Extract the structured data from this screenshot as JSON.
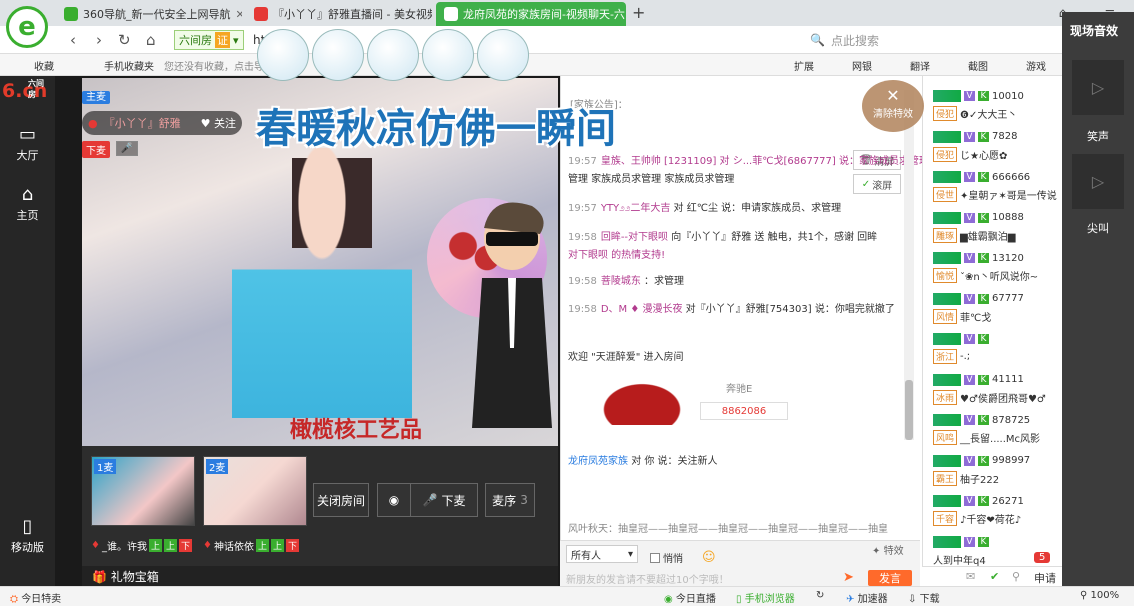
{
  "tabs": [
    {
      "label": "360导航_新一代安全上网导航",
      "color": "#3aae2f"
    },
    {
      "label": "『小丫丫』舒雅直播间 - 美女视频",
      "color": "#e53935"
    },
    {
      "label": "龙府凤苑的家族房间-视频聊天-六",
      "color": "#3aae2f"
    }
  ],
  "address": {
    "site_tag": "六间房",
    "cert": "证",
    "url": "http://6",
    "search_placeholder": "点此搜索"
  },
  "favbar": {
    "fav": "收藏",
    "mobile_fav": "手机收藏夹",
    "hint": "您还没有收藏，点击导",
    "ext": "扩展",
    "bank": "网银",
    "translate": "翻译",
    "screenshot": "截图",
    "games": "游戏"
  },
  "leftnav": {
    "logo": "6.cn",
    "logo_small": "六间房",
    "hall": "大厅",
    "home": "主页",
    "mobile": "移动版"
  },
  "stage": {
    "host_tag": "主麦",
    "anchor_name": "『小丫丫』舒雅",
    "follow": "关注",
    "mic_down_tag": "下麦",
    "banner": "春暖秋凉仿佛一瞬间",
    "subtitle": "橄榄核工艺品",
    "mic1_label": "1麦",
    "mic2_label": "2麦",
    "mic1_name": "_谁。许我",
    "mic2_name": "神话依依",
    "up": "上",
    "down": "下",
    "close_room": "关闭房间",
    "mic_down_btn": "下麦",
    "mic_queue": "麦序",
    "mic_queue_count": "3",
    "gift_box": "礼物宝箱"
  },
  "chat": {
    "notice": "[家族公告]：",
    "clear_fx": "清除特效",
    "clear_screen": "清屏",
    "scroll_screen": "滚屏",
    "messages": [
      {
        "time": "19:57",
        "user": "皇族、王帅帅 [1231109] 对 シ...菲℃戈[6867777] 说：家族成员求管理",
        "extra": "管理 家族成员求管理 家族成员求管理"
      },
      {
        "time": "19:57",
        "user": "YTY೨೨二年大吉",
        "text": "对 红℃尘 说：申请家族成员、求管理"
      },
      {
        "time": "19:58",
        "user": "回眸--对下眼呗",
        "text": "向『小丫丫』舒雅 送 触电，共1个，感谢 回眸",
        "extra": "对下眼呗 的热情支持!"
      },
      {
        "time": "19:58",
        "user": "菩陵城东",
        "text": "：求管理"
      },
      {
        "time": "19:58",
        "user": "D、M ♦ 漫漫长夜",
        "text": "对『小丫丫』舒雅[754303] 说：你唱完就撤了"
      }
    ],
    "welcome": "欢迎 \"天涯醉爱\" 进入房间",
    "car_name": "奔驰E",
    "car_num": "8862086",
    "family_msg_user": "龙府凤苑家族",
    "family_msg_text": "对 你 说：关注新人",
    "ticker": "风叶秋天：抽皇冠——抽皇冠——抽皇冠——抽皇冠——抽皇冠——抽皇",
    "target": "所有人",
    "private": "悄悄",
    "fx": "特效",
    "input_placeholder": "新朋友的发言请不要超过10个字哦！",
    "send": "发言"
  },
  "users": [
    {
      "fan": "侵犯",
      "id": "10010",
      "name": "❻✓大大王丶"
    },
    {
      "fan": "侵犯",
      "id": "7828",
      "name": "じ★心愿✿"
    },
    {
      "fan": "侵世",
      "id": "666666",
      "name": "✦皇朝ァ✶哥是一传说"
    },
    {
      "fan": "雕琢",
      "id": "10888",
      "name": "▆雄霸飘泊▆"
    },
    {
      "fan": "愉悦",
      "id": "13120",
      "name": "ˇ❀ո丶听风说你~"
    },
    {
      "fan": "风情",
      "id": "67777",
      "name": "菲℃戈"
    },
    {
      "fan": "浙江",
      "id": "",
      "name": "-.;"
    },
    {
      "fan": "冰雨",
      "id": "41111",
      "name": "♥♂侯爵团飛哥♥♂"
    },
    {
      "fan": "风鸣",
      "id": "878725",
      "name": "__長留.....Mc风影"
    },
    {
      "fan": "霸王",
      "id": "998997",
      "name": "柚子222"
    },
    {
      "fan": "千容",
      "id": "26271",
      "name": "♪千容❤荷花♪"
    },
    {
      "fan": "",
      "id": "",
      "name": "人到中年q4"
    }
  ],
  "userfoot": {
    "apply": "申请",
    "badge": "5"
  },
  "rightpanel": {
    "title": "现场音效",
    "laugh": "笑声",
    "scream": "尖叫"
  },
  "statusbar": {
    "special": "今日特卖",
    "live": "今日直播",
    "mobile_browser": "手机浏览器",
    "accel": "加速器",
    "download": "下载",
    "zoom": "100%"
  }
}
